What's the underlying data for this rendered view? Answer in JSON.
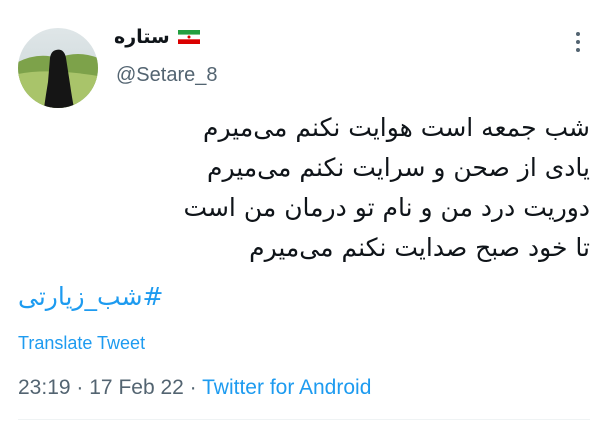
{
  "author": {
    "display_name": "ستاره",
    "handle": "@Setare_8",
    "flag_icon": "iran-flag-icon",
    "avatar_icon": "profile-photo"
  },
  "tweet": {
    "lines": [
      "شب جمعه است هوایت نکنم می‌میرم",
      "یادی از صحن و سرایت نکنم می‌میرم",
      "دوریت درد من و نام تو درمان من است",
      "تا خود صبح صدایت نکنم می‌میرم"
    ],
    "hashtag": "#شب_زیارتی",
    "translate_label": "Translate Tweet"
  },
  "meta": {
    "time": "23:19",
    "separator": "·",
    "date": "17 Feb 22",
    "source": "Twitter for Android"
  },
  "colors": {
    "link": "#1d9bf0",
    "secondary_text": "#536471",
    "primary_text": "#0f1419"
  }
}
